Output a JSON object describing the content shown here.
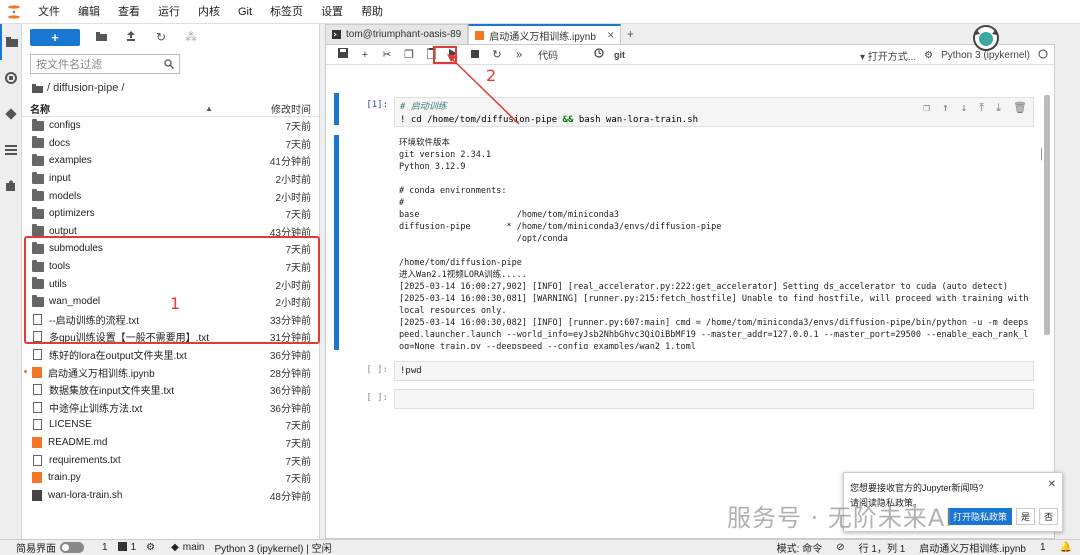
{
  "menu": [
    "文件",
    "编辑",
    "查看",
    "运行",
    "内核",
    "Git",
    "标签页",
    "设置",
    "帮助"
  ],
  "filebrowser": {
    "new_label": "+",
    "filter_placeholder": "按文件名过滤",
    "breadcrumb": "/ diffusion-pipe /",
    "col_name": "名称",
    "col_modified": "修改时间",
    "items": [
      {
        "name": "configs",
        "type": "folder",
        "time": "7天前"
      },
      {
        "name": "docs",
        "type": "folder",
        "time": "7天前"
      },
      {
        "name": "examples",
        "type": "folder",
        "time": "41分钟前"
      },
      {
        "name": "input",
        "type": "folder",
        "time": "2小时前"
      },
      {
        "name": "models",
        "type": "folder",
        "time": "2小时前"
      },
      {
        "name": "optimizers",
        "type": "folder",
        "time": "7天前"
      },
      {
        "name": "output",
        "type": "folder",
        "time": "43分钟前"
      },
      {
        "name": "submodules",
        "type": "folder",
        "time": "7天前"
      },
      {
        "name": "tools",
        "type": "folder",
        "time": "7天前"
      },
      {
        "name": "utils",
        "type": "folder",
        "time": "2小时前"
      },
      {
        "name": "wan_model",
        "type": "folder",
        "time": "2小时前"
      },
      {
        "name": "--启动训练的流程.txt",
        "type": "file",
        "time": "33分钟前"
      },
      {
        "name": "多gpu训练设置【一般不需要用】.txt",
        "type": "file",
        "time": "31分钟前"
      },
      {
        "name": "练好的lora在output文件夹里.txt",
        "type": "file",
        "time": "36分钟前"
      },
      {
        "name": "启动通义万相训练.ipynb",
        "type": "notebook",
        "time": "28分钟前"
      },
      {
        "name": "数据集放在input文件夹里.txt",
        "type": "file",
        "time": "36分钟前"
      },
      {
        "name": "中途停止训练方法.txt",
        "type": "file",
        "time": "36分钟前"
      },
      {
        "name": "LICENSE",
        "type": "file",
        "time": "7天前"
      },
      {
        "name": "README.md",
        "type": "markdown",
        "time": "7天前"
      },
      {
        "name": "requirements.txt",
        "type": "file",
        "time": "7天前"
      },
      {
        "name": "train.py",
        "type": "python",
        "time": "7天前"
      },
      {
        "name": "wan-lora-train.sh",
        "type": "shell",
        "time": "48分钟前"
      }
    ]
  },
  "annotations": {
    "one": "1",
    "two": "2"
  },
  "tabs": [
    {
      "label": "tom@triumphant-oasis-89"
    },
    {
      "label": "启动通义万相训练.ipynb"
    }
  ],
  "notebook_toolbar": {
    "cell_type": "代码",
    "git": "git",
    "open_with": "打开方式...",
    "kernel": "Python 3 (ipykernel)"
  },
  "cells": {
    "c1_prompt": "[1]:",
    "c1_line1": "# 启动训练",
    "c1_line2_cmd": "! cd /home/tom/diffusion-pipe",
    "c1_line2_op": " && ",
    "c1_line2_rest": "bash wan-lora-train.sh",
    "output": "环境软件版本\ngit version 2.34.1\nPython 3.12.9\n\n# conda environments:\n#\nbase                   /home/tom/miniconda3\ndiffusion-pipe       * /home/tom/miniconda3/envs/diffusion-pipe\n                       /opt/conda\n\n/home/tom/diffusion-pipe\n进入Wan2.1视频LORA训练.....\n[2025-03-14 16:00:27,902] [INFO] [real_accelerator.py:222:get_accelerator] Setting ds_accelerator to cuda (auto detect)\n[2025-03-14 16:00:30,081] [WARNING] [runner.py:215:fetch_hostfile] Unable to find hostfile, will proceed with training with\nlocal resources only.\n[2025-03-14 16:00:30,082] [INFO] [runner.py:607:main] cmd = /home/tom/miniconda3/envs/diffusion-pipe/bin/python -u -m deeps\npeed.launcher.launch --world_info=eyJsb2NhbGhvc3QiOiBbMF19 --master_addr=127.0.0.1 --master_port=29500 --enable_each_rank_l\nog=None train.py --deepspeed --config examples/wan2_1.toml",
    "c2_prompt": "[ ]:",
    "c2_code": "!pwd",
    "c3_prompt": "[ ]:"
  },
  "notification": {
    "line1": "您想要接收官方的Jupyter新闻吗?",
    "line2": "请阅读隐私政策。",
    "open_privacy": "打开隐私政策",
    "yes": "是",
    "no": "否"
  },
  "watermark": "服务号 · 无阶未来AI",
  "status": {
    "simple": "简易界面",
    "count1": "1",
    "count2": "1",
    "branch": "main",
    "kernel": "Python 3 (ipykernel) | 空闲",
    "mode": "模式: 命令",
    "pos": "行 1，列 1",
    "file": "启动通义万相训练.ipynb",
    "count3": "1"
  }
}
